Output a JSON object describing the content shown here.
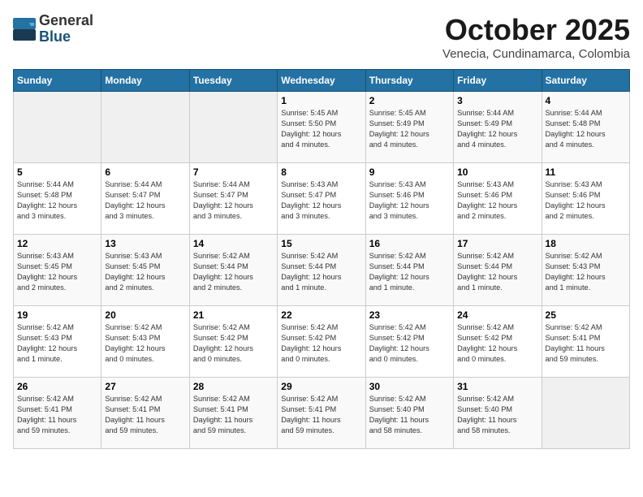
{
  "header": {
    "logo_general": "General",
    "logo_blue": "Blue",
    "month": "October 2025",
    "location": "Venecia, Cundinamarca, Colombia"
  },
  "weekdays": [
    "Sunday",
    "Monday",
    "Tuesday",
    "Wednesday",
    "Thursday",
    "Friday",
    "Saturday"
  ],
  "weeks": [
    [
      {
        "day": "",
        "info": ""
      },
      {
        "day": "",
        "info": ""
      },
      {
        "day": "",
        "info": ""
      },
      {
        "day": "1",
        "info": "Sunrise: 5:45 AM\nSunset: 5:50 PM\nDaylight: 12 hours\nand 4 minutes."
      },
      {
        "day": "2",
        "info": "Sunrise: 5:45 AM\nSunset: 5:49 PM\nDaylight: 12 hours\nand 4 minutes."
      },
      {
        "day": "3",
        "info": "Sunrise: 5:44 AM\nSunset: 5:49 PM\nDaylight: 12 hours\nand 4 minutes."
      },
      {
        "day": "4",
        "info": "Sunrise: 5:44 AM\nSunset: 5:48 PM\nDaylight: 12 hours\nand 4 minutes."
      }
    ],
    [
      {
        "day": "5",
        "info": "Sunrise: 5:44 AM\nSunset: 5:48 PM\nDaylight: 12 hours\nand 3 minutes."
      },
      {
        "day": "6",
        "info": "Sunrise: 5:44 AM\nSunset: 5:47 PM\nDaylight: 12 hours\nand 3 minutes."
      },
      {
        "day": "7",
        "info": "Sunrise: 5:44 AM\nSunset: 5:47 PM\nDaylight: 12 hours\nand 3 minutes."
      },
      {
        "day": "8",
        "info": "Sunrise: 5:43 AM\nSunset: 5:47 PM\nDaylight: 12 hours\nand 3 minutes."
      },
      {
        "day": "9",
        "info": "Sunrise: 5:43 AM\nSunset: 5:46 PM\nDaylight: 12 hours\nand 3 minutes."
      },
      {
        "day": "10",
        "info": "Sunrise: 5:43 AM\nSunset: 5:46 PM\nDaylight: 12 hours\nand 2 minutes."
      },
      {
        "day": "11",
        "info": "Sunrise: 5:43 AM\nSunset: 5:46 PM\nDaylight: 12 hours\nand 2 minutes."
      }
    ],
    [
      {
        "day": "12",
        "info": "Sunrise: 5:43 AM\nSunset: 5:45 PM\nDaylight: 12 hours\nand 2 minutes."
      },
      {
        "day": "13",
        "info": "Sunrise: 5:43 AM\nSunset: 5:45 PM\nDaylight: 12 hours\nand 2 minutes."
      },
      {
        "day": "14",
        "info": "Sunrise: 5:42 AM\nSunset: 5:44 PM\nDaylight: 12 hours\nand 2 minutes."
      },
      {
        "day": "15",
        "info": "Sunrise: 5:42 AM\nSunset: 5:44 PM\nDaylight: 12 hours\nand 1 minute."
      },
      {
        "day": "16",
        "info": "Sunrise: 5:42 AM\nSunset: 5:44 PM\nDaylight: 12 hours\nand 1 minute."
      },
      {
        "day": "17",
        "info": "Sunrise: 5:42 AM\nSunset: 5:44 PM\nDaylight: 12 hours\nand 1 minute."
      },
      {
        "day": "18",
        "info": "Sunrise: 5:42 AM\nSunset: 5:43 PM\nDaylight: 12 hours\nand 1 minute."
      }
    ],
    [
      {
        "day": "19",
        "info": "Sunrise: 5:42 AM\nSunset: 5:43 PM\nDaylight: 12 hours\nand 1 minute."
      },
      {
        "day": "20",
        "info": "Sunrise: 5:42 AM\nSunset: 5:43 PM\nDaylight: 12 hours\nand 0 minutes."
      },
      {
        "day": "21",
        "info": "Sunrise: 5:42 AM\nSunset: 5:42 PM\nDaylight: 12 hours\nand 0 minutes."
      },
      {
        "day": "22",
        "info": "Sunrise: 5:42 AM\nSunset: 5:42 PM\nDaylight: 12 hours\nand 0 minutes."
      },
      {
        "day": "23",
        "info": "Sunrise: 5:42 AM\nSunset: 5:42 PM\nDaylight: 12 hours\nand 0 minutes."
      },
      {
        "day": "24",
        "info": "Sunrise: 5:42 AM\nSunset: 5:42 PM\nDaylight: 12 hours\nand 0 minutes."
      },
      {
        "day": "25",
        "info": "Sunrise: 5:42 AM\nSunset: 5:41 PM\nDaylight: 11 hours\nand 59 minutes."
      }
    ],
    [
      {
        "day": "26",
        "info": "Sunrise: 5:42 AM\nSunset: 5:41 PM\nDaylight: 11 hours\nand 59 minutes."
      },
      {
        "day": "27",
        "info": "Sunrise: 5:42 AM\nSunset: 5:41 PM\nDaylight: 11 hours\nand 59 minutes."
      },
      {
        "day": "28",
        "info": "Sunrise: 5:42 AM\nSunset: 5:41 PM\nDaylight: 11 hours\nand 59 minutes."
      },
      {
        "day": "29",
        "info": "Sunrise: 5:42 AM\nSunset: 5:41 PM\nDaylight: 11 hours\nand 59 minutes."
      },
      {
        "day": "30",
        "info": "Sunrise: 5:42 AM\nSunset: 5:40 PM\nDaylight: 11 hours\nand 58 minutes."
      },
      {
        "day": "31",
        "info": "Sunrise: 5:42 AM\nSunset: 5:40 PM\nDaylight: 11 hours\nand 58 minutes."
      },
      {
        "day": "",
        "info": ""
      }
    ]
  ]
}
